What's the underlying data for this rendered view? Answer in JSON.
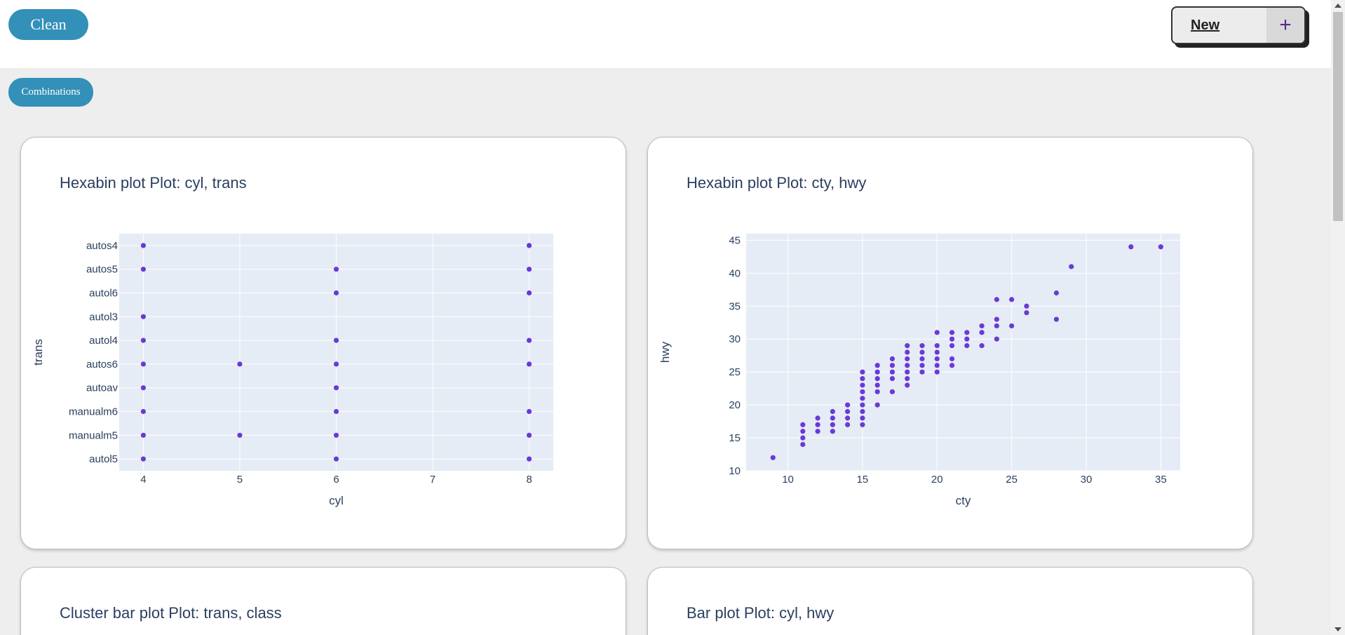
{
  "header": {
    "clean_label": "Clean",
    "new_label": "New",
    "new_plus": "+"
  },
  "combinations_label": "Combinations",
  "cards": [
    {
      "title": "Hexabin plot Plot: cyl, trans"
    },
    {
      "title": "Hexabin plot Plot: cty, hwy"
    },
    {
      "title": "Cluster bar plot Plot: trans, class"
    },
    {
      "title": "Bar plot Plot: cyl, hwy"
    }
  ],
  "colors": {
    "accent": "#3390b8",
    "marker": "#6a3ad6",
    "plot_bg": "#e5ecf6",
    "text": "#2a3f5f"
  },
  "chart_data": [
    {
      "type": "scatter",
      "xlabel": "cyl",
      "ylabel": "trans",
      "xlim": [
        3.75,
        8.25
      ],
      "xticks": [
        4,
        5,
        6,
        7,
        8
      ],
      "categories": [
        "autol5",
        "manualm5",
        "manualm6",
        "autoav",
        "autos6",
        "autol4",
        "autol3",
        "autol6",
        "autos5",
        "autos4"
      ],
      "points": [
        [
          4,
          "autos4"
        ],
        [
          8,
          "autos4"
        ],
        [
          4,
          "autos5"
        ],
        [
          6,
          "autos5"
        ],
        [
          8,
          "autos5"
        ],
        [
          6,
          "autol6"
        ],
        [
          8,
          "autol6"
        ],
        [
          4,
          "autol3"
        ],
        [
          4,
          "autol4"
        ],
        [
          6,
          "autol4"
        ],
        [
          8,
          "autol4"
        ],
        [
          4,
          "autos6"
        ],
        [
          5,
          "autos6"
        ],
        [
          6,
          "autos6"
        ],
        [
          8,
          "autos6"
        ],
        [
          4,
          "autoav"
        ],
        [
          6,
          "autoav"
        ],
        [
          4,
          "manualm6"
        ],
        [
          6,
          "manualm6"
        ],
        [
          8,
          "manualm6"
        ],
        [
          4,
          "manualm5"
        ],
        [
          5,
          "manualm5"
        ],
        [
          6,
          "manualm5"
        ],
        [
          8,
          "manualm5"
        ],
        [
          4,
          "autol5"
        ],
        [
          6,
          "autol5"
        ],
        [
          8,
          "autol5"
        ]
      ]
    },
    {
      "type": "scatter",
      "xlabel": "cty",
      "ylabel": "hwy",
      "xlim": [
        7.2,
        36.3
      ],
      "ylim": [
        10,
        46
      ],
      "xticks": [
        10,
        15,
        20,
        25,
        30,
        35
      ],
      "yticks": [
        10,
        15,
        20,
        25,
        30,
        35,
        40,
        45
      ],
      "points": [
        [
          9,
          12
        ],
        [
          11,
          14
        ],
        [
          11,
          15
        ],
        [
          11,
          16
        ],
        [
          11,
          17
        ],
        [
          12,
          16
        ],
        [
          12,
          17
        ],
        [
          12,
          18
        ],
        [
          13,
          16
        ],
        [
          13,
          17
        ],
        [
          13,
          18
        ],
        [
          13,
          19
        ],
        [
          14,
          17
        ],
        [
          14,
          18
        ],
        [
          14,
          19
        ],
        [
          14,
          20
        ],
        [
          15,
          17
        ],
        [
          15,
          18
        ],
        [
          15,
          19
        ],
        [
          15,
          20
        ],
        [
          15,
          21
        ],
        [
          15,
          22
        ],
        [
          15,
          23
        ],
        [
          15,
          24
        ],
        [
          15,
          25
        ],
        [
          16,
          20
        ],
        [
          16,
          22
        ],
        [
          16,
          23
        ],
        [
          16,
          24
        ],
        [
          16,
          25
        ],
        [
          16,
          26
        ],
        [
          17,
          22
        ],
        [
          17,
          24
        ],
        [
          17,
          25
        ],
        [
          17,
          26
        ],
        [
          17,
          27
        ],
        [
          18,
          23
        ],
        [
          18,
          24
        ],
        [
          18,
          25
        ],
        [
          18,
          26
        ],
        [
          18,
          27
        ],
        [
          18,
          28
        ],
        [
          18,
          29
        ],
        [
          19,
          25
        ],
        [
          19,
          26
        ],
        [
          19,
          27
        ],
        [
          19,
          28
        ],
        [
          19,
          29
        ],
        [
          20,
          25
        ],
        [
          20,
          26
        ],
        [
          20,
          27
        ],
        [
          20,
          28
        ],
        [
          20,
          29
        ],
        [
          20,
          31
        ],
        [
          21,
          26
        ],
        [
          21,
          27
        ],
        [
          21,
          29
        ],
        [
          21,
          30
        ],
        [
          21,
          31
        ],
        [
          22,
          29
        ],
        [
          22,
          30
        ],
        [
          22,
          31
        ],
        [
          23,
          29
        ],
        [
          23,
          31
        ],
        [
          23,
          32
        ],
        [
          24,
          30
        ],
        [
          24,
          32
        ],
        [
          24,
          33
        ],
        [
          24,
          36
        ],
        [
          25,
          32
        ],
        [
          25,
          36
        ],
        [
          26,
          34
        ],
        [
          26,
          35
        ],
        [
          28,
          33
        ],
        [
          28,
          37
        ],
        [
          29,
          41
        ],
        [
          33,
          44
        ],
        [
          35,
          44
        ]
      ]
    }
  ]
}
